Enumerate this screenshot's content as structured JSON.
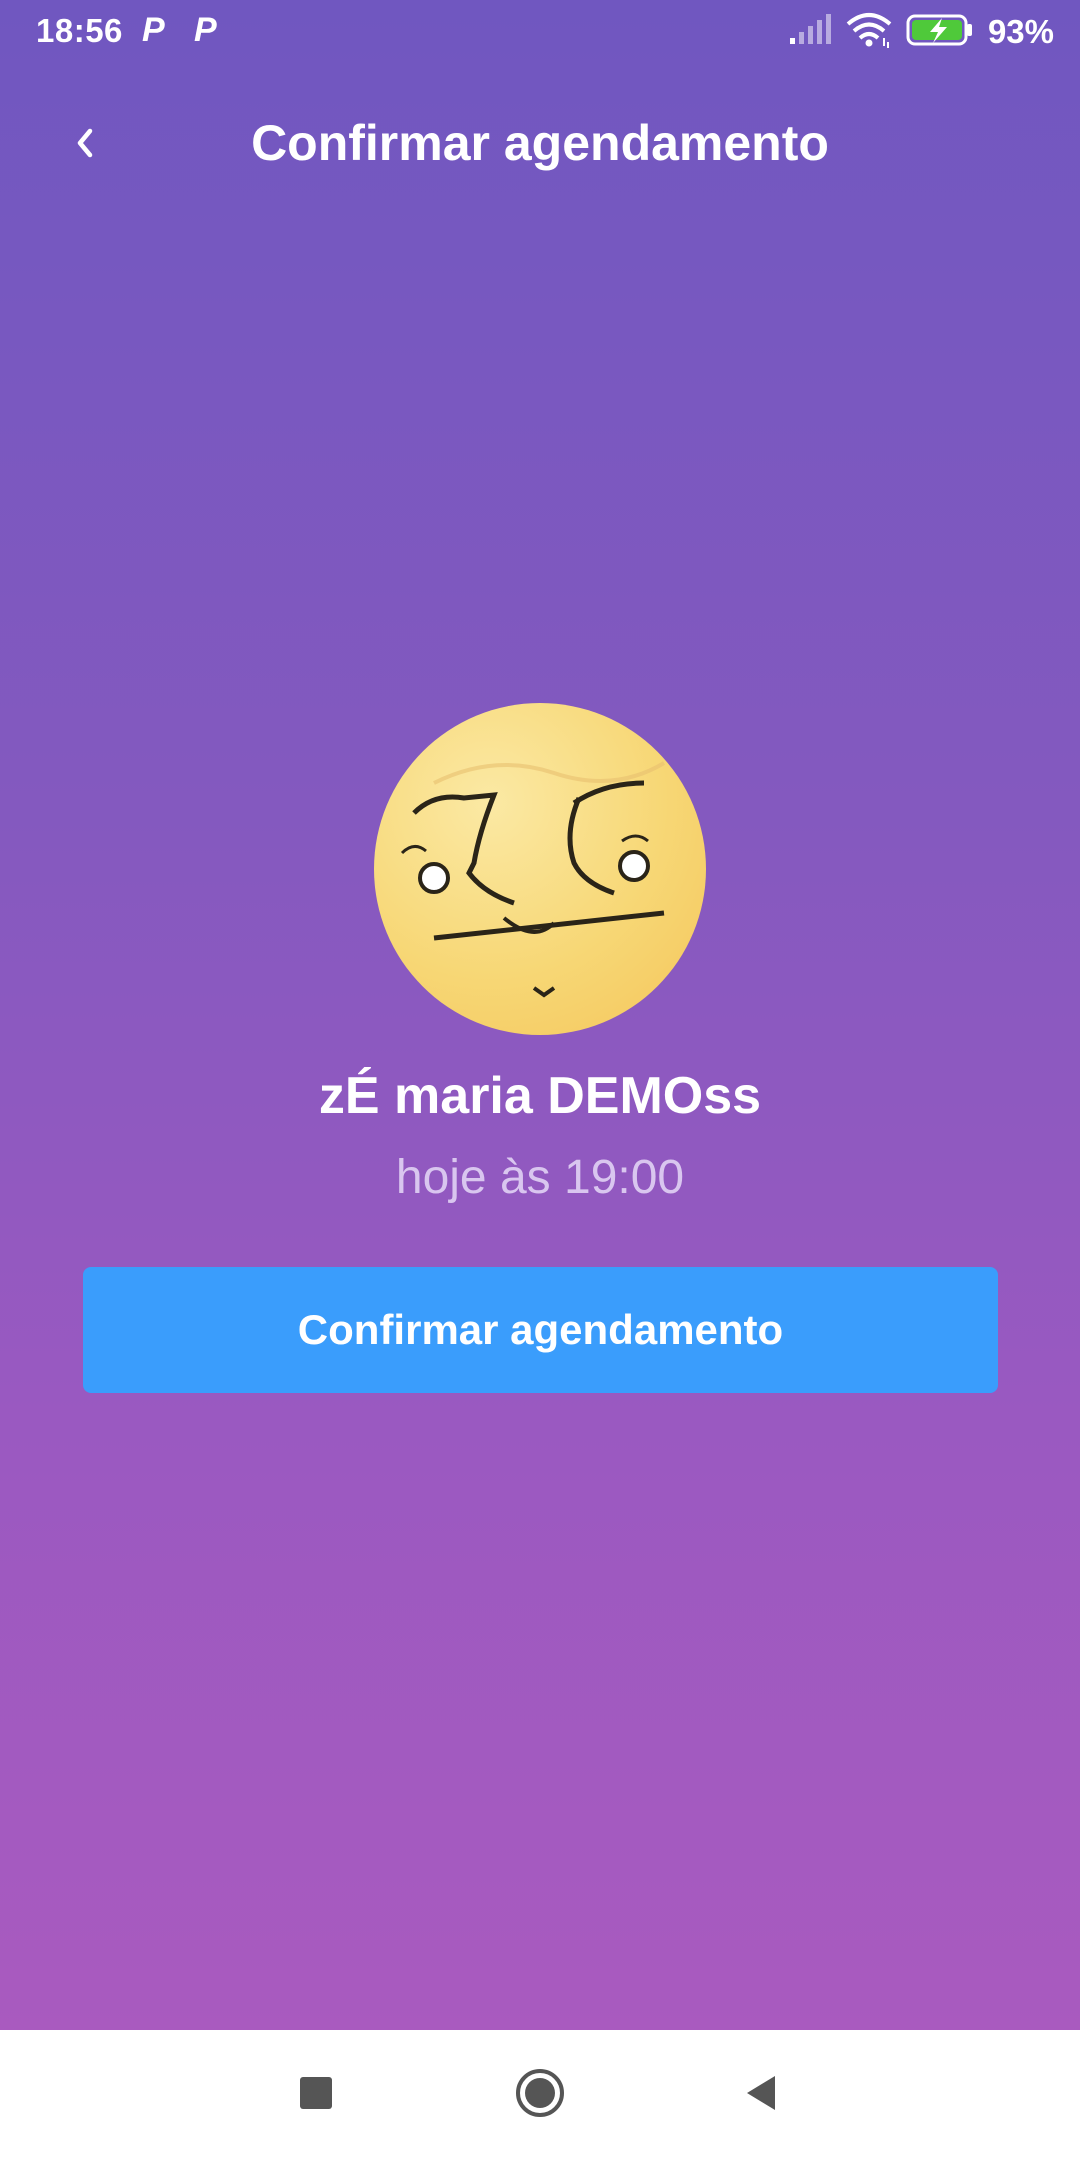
{
  "status_bar": {
    "time": "18:56",
    "notification_icons": [
      "p-app-icon",
      "p-app-icon"
    ],
    "notification_glyph": "P",
    "battery_percent": "93%",
    "icons": [
      "signal-icon",
      "wifi-icon",
      "battery-charging-icon"
    ]
  },
  "header": {
    "title": "Confirmar agendamento",
    "back_icon": "chevron-left-icon"
  },
  "profile": {
    "name": "zÉ maria DEMOss",
    "schedule": "hoje às 19:00"
  },
  "actions": {
    "confirm_label": "Confirmar agendamento"
  },
  "nav_bar": {
    "icons": [
      "recent-apps-icon",
      "home-icon",
      "back-triangle-icon"
    ]
  },
  "colors": {
    "gradient_top": "#7057c0",
    "gradient_bottom": "#a95abf",
    "button": "#3a9dfc",
    "subtitle": "#d9c6ef"
  }
}
